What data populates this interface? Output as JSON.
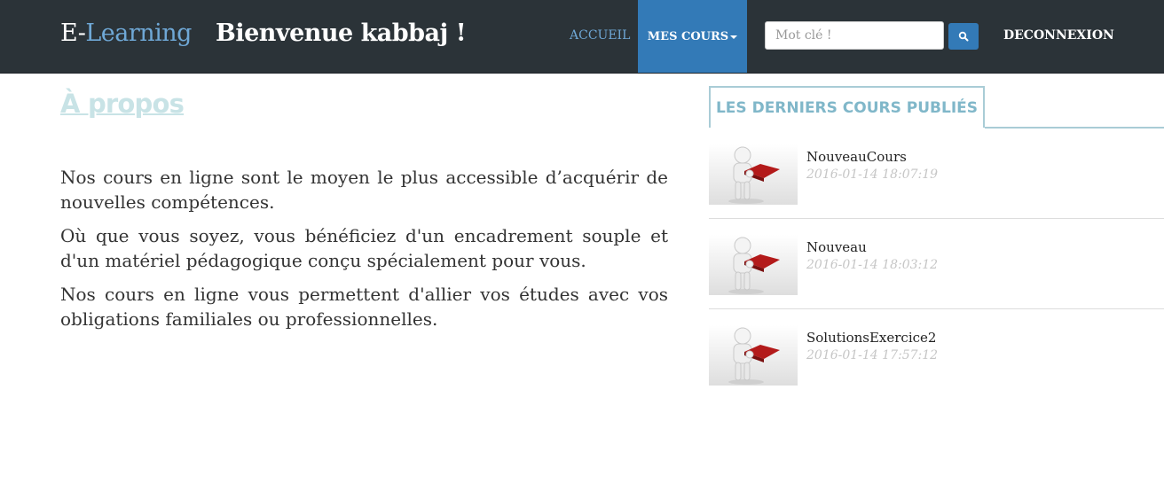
{
  "navbar": {
    "brand_e": "E-",
    "brand_learning": "Learning",
    "welcome": "Bienvenue  kabbaj !",
    "accueil": "ACCUEIL",
    "mes_cours": "MES COURS",
    "search_placeholder": "Mot clé !",
    "logout": "DECONNEXION",
    "accent_color": "#337ab7",
    "bg_color": "#2b3338"
  },
  "about": {
    "title": "À propos",
    "paragraphs": [
      "Nos cours en ligne sont le moyen le plus accessible d’acquérir de nouvelles compétences.",
      "Où que vous soyez, vous bénéficiez d'un encadrement souple et d'un matériel pédagogique conçu spécialement pour vous.",
      "Nos cours en ligne vous permettent d'allier vos études avec vos obligations familiales ou professionnelles."
    ]
  },
  "latest": {
    "tab_label": "LES DERNIERS COURS PUBLIÉS",
    "courses": [
      {
        "name": "NouveauCours",
        "date": "2016-01-14 18:07:19"
      },
      {
        "name": "Nouveau",
        "date": "2016-01-14 18:03:12"
      },
      {
        "name": "SolutionsExercice2",
        "date": "2016-01-14 17:57:12"
      }
    ]
  }
}
